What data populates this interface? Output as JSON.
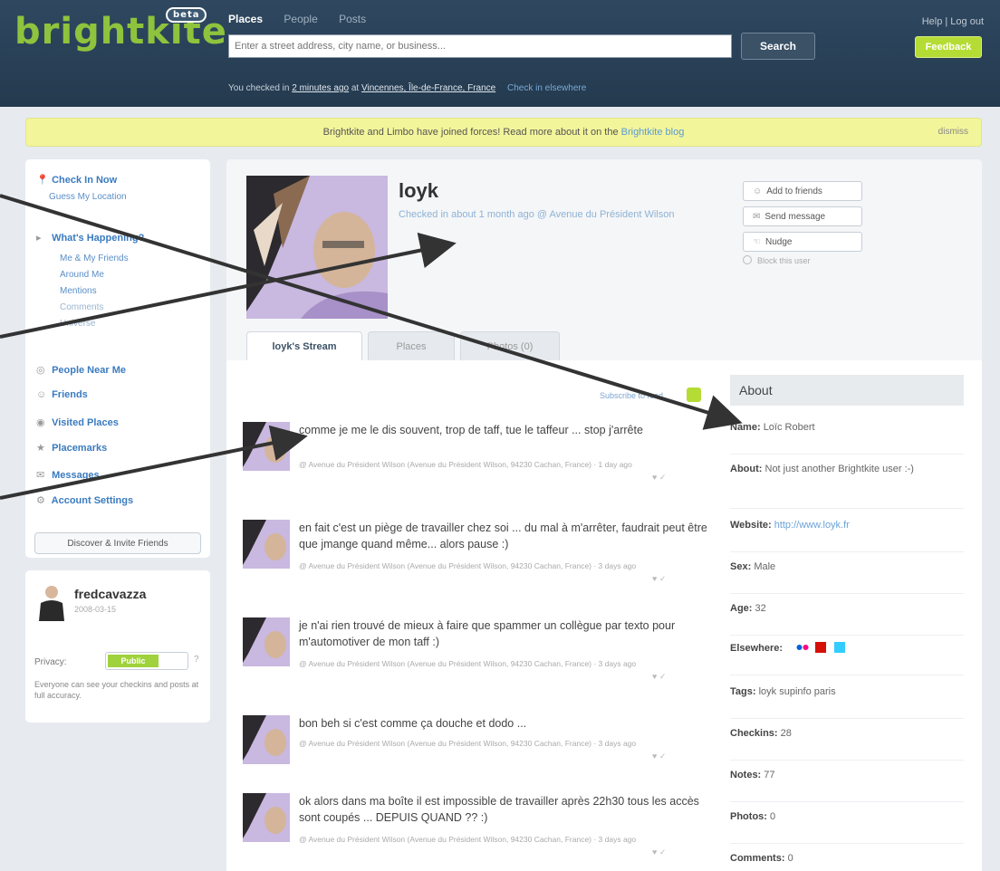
{
  "header": {
    "logo": "brightkite",
    "beta": "beta",
    "nav_tabs": [
      "Places",
      "People",
      "Posts"
    ],
    "search_placeholder": "Enter a street address, city name, or business...",
    "search_button": "Search",
    "top_links": "Help | Log out",
    "feedback_button": "Feedback",
    "checked_prefix": "You checked in",
    "checked_time": "2 minutes ago",
    "checked_at": "at",
    "checked_place": "Vincennes, Île-de-France, France",
    "check_in_elsewhere": "Check in elsewhere"
  },
  "notice": {
    "text": "Brightkite and Limbo have joined forces! Read more about it on the",
    "link": "Brightkite blog",
    "dismiss": "dismiss"
  },
  "sidebar": {
    "check_in_now": "Check In Now",
    "guess_location": "Guess My Location",
    "whats_happening": "What's Happening?",
    "sub_items": [
      "Me & My Friends",
      "Around Me",
      "Mentions",
      "Comments",
      "Universe"
    ],
    "items": [
      "People Near Me",
      "Friends",
      "Visited Places",
      "Placemarks",
      "Messages",
      "Account Settings"
    ],
    "discover_button": "Discover & Invite Friends"
  },
  "userbox": {
    "name": "fredcavazza",
    "date": "2008-03-15",
    "privacy_label": "Privacy:",
    "privacy_value": "Public",
    "privacy_help": "?",
    "privacy_desc": "Everyone can see your checkins and posts at full accuracy."
  },
  "profile": {
    "name": "loyk",
    "location": "Checked in about 1 month ago @ Avenue du Président Wilson",
    "actions": [
      "Add to friends",
      "Send message",
      "Nudge"
    ],
    "block": "Block this user"
  },
  "tabs": [
    "loyk's Stream",
    "Places",
    "Photos (0)"
  ],
  "stream": {
    "rss": "Subscribe to feed",
    "posts": [
      {
        "text": "comme je me le dis souvent, trop de taff, tue le taffeur ... stop j'arrête",
        "meta": "@ Avenue du Président Wilson (Avenue du Président Wilson, 94230 Cachan, France) · 1 day ago"
      },
      {
        "text": "en fait c'est un piège de travailler chez soi ... du mal à m'arrêter, faudrait peut être que jmange quand même... alors pause :)",
        "meta": "@ Avenue du Président Wilson (Avenue du Président Wilson, 94230 Cachan, France) · 3 days ago"
      },
      {
        "text": "je n'ai rien trouvé de mieux à faire que spammer un collègue par texto pour m'automotiver de mon taff :)",
        "meta": "@ Avenue du Président Wilson (Avenue du Président Wilson, 94230 Cachan, France) · 3 days ago"
      },
      {
        "text": "bon beh si c'est comme ça douche et dodo ...",
        "meta": "@ Avenue du Président Wilson (Avenue du Président Wilson, 94230 Cachan, France) · 3 days ago"
      },
      {
        "text": "ok alors dans ma boîte il est impossible de travailler après 22h30 tous les accès sont coupés ... DEPUIS QUAND ?? :)",
        "meta": "@ Avenue du Président Wilson (Avenue du Président Wilson, 94230 Cachan, France) · 3 days ago"
      }
    ]
  },
  "about": {
    "title": "About",
    "name_label": "Name:",
    "name": "Loïc Robert",
    "about_label": "About:",
    "about": "Not just another Brightkite user :-)",
    "website_label": "Website:",
    "website": "http://www.loyk.fr",
    "sex_label": "Sex:",
    "sex": "Male",
    "age_label": "Age:",
    "age": "32",
    "elsewhere_label": "Elsewhere:",
    "tags_label": "Tags:",
    "tags": "loyk supinfo paris",
    "checkins_label": "Checkins:",
    "checkins": "28",
    "notes_label": "Notes:",
    "notes": "77",
    "photos_label": "Photos:",
    "photos": "0",
    "comments_label": "Comments:",
    "comments": "0"
  },
  "colors": {
    "header_bg": "#2b4157",
    "logo_green": "#8ec33d",
    "notice_bg": "#f3f59b",
    "link_blue": "#3a7bbf",
    "annotation_arrow": "#333333"
  }
}
